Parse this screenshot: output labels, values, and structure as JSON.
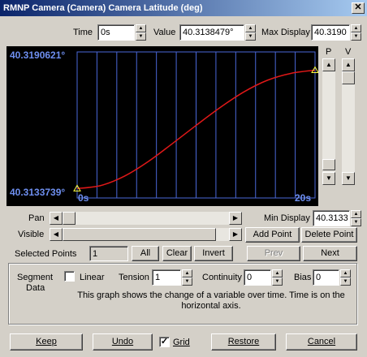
{
  "window": {
    "title": "RMNP Camera (Camera) Camera Latitude (deg)",
    "close_glyph": "✕"
  },
  "top": {
    "time_label": "Time",
    "time_value": "0s",
    "value_label": "Value",
    "value_value": "40.3138479°",
    "max_label": "Max Display",
    "max_value": "40.3190"
  },
  "graph": {
    "max_text": "40.3190621°",
    "min_text": "40.3133739°",
    "t_start": "0s",
    "t_end": "20s",
    "p_label": "P",
    "v_label": "V"
  },
  "chart_data": {
    "type": "line",
    "x_range": [
      0,
      20
    ],
    "y_range": [
      40.3133739,
      40.3190621
    ],
    "grid": true,
    "grid_columns": 12,
    "series": [
      {
        "x": [
          0,
          2,
          4,
          6,
          8,
          10,
          12,
          14,
          16,
          18,
          20
        ],
        "y": [
          40.31374,
          40.31386,
          40.31423,
          40.3148,
          40.31549,
          40.3162,
          40.31689,
          40.3175,
          40.31796,
          40.31823,
          40.31835
        ],
        "color": "#e01818"
      }
    ],
    "keyframes": [
      {
        "x": 0,
        "y": 40.31374
      },
      {
        "x": 20,
        "y": 40.31835
      }
    ]
  },
  "controls": {
    "pan_label": "Pan",
    "visible_label": "Visible",
    "min_display_label": "Min Display",
    "min_display_value": "40.3133",
    "add_point": "Add Point",
    "delete_point": "Delete Point",
    "selected_points_label": "Selected Points",
    "selected_points_value": "1",
    "all": "All",
    "clear": "Clear",
    "invert": "Invert",
    "prev": "Prev",
    "next": "Next"
  },
  "segment": {
    "title_line1": "Segment",
    "title_line2": "Data",
    "linear_label": "Linear",
    "tension_label": "Tension",
    "tension_value": "1",
    "continuity_label": "Continuity",
    "continuity_value": "0",
    "bias_label": "Bias",
    "bias_value": "0",
    "help_text": "This graph shows the change of a variable over time. Time is on the horizontal axis."
  },
  "bottom": {
    "keep": "Keep",
    "undo": "Undo",
    "grid_label": "Grid",
    "grid_checked": "✓",
    "restore": "Restore",
    "cancel": "Cancel"
  }
}
